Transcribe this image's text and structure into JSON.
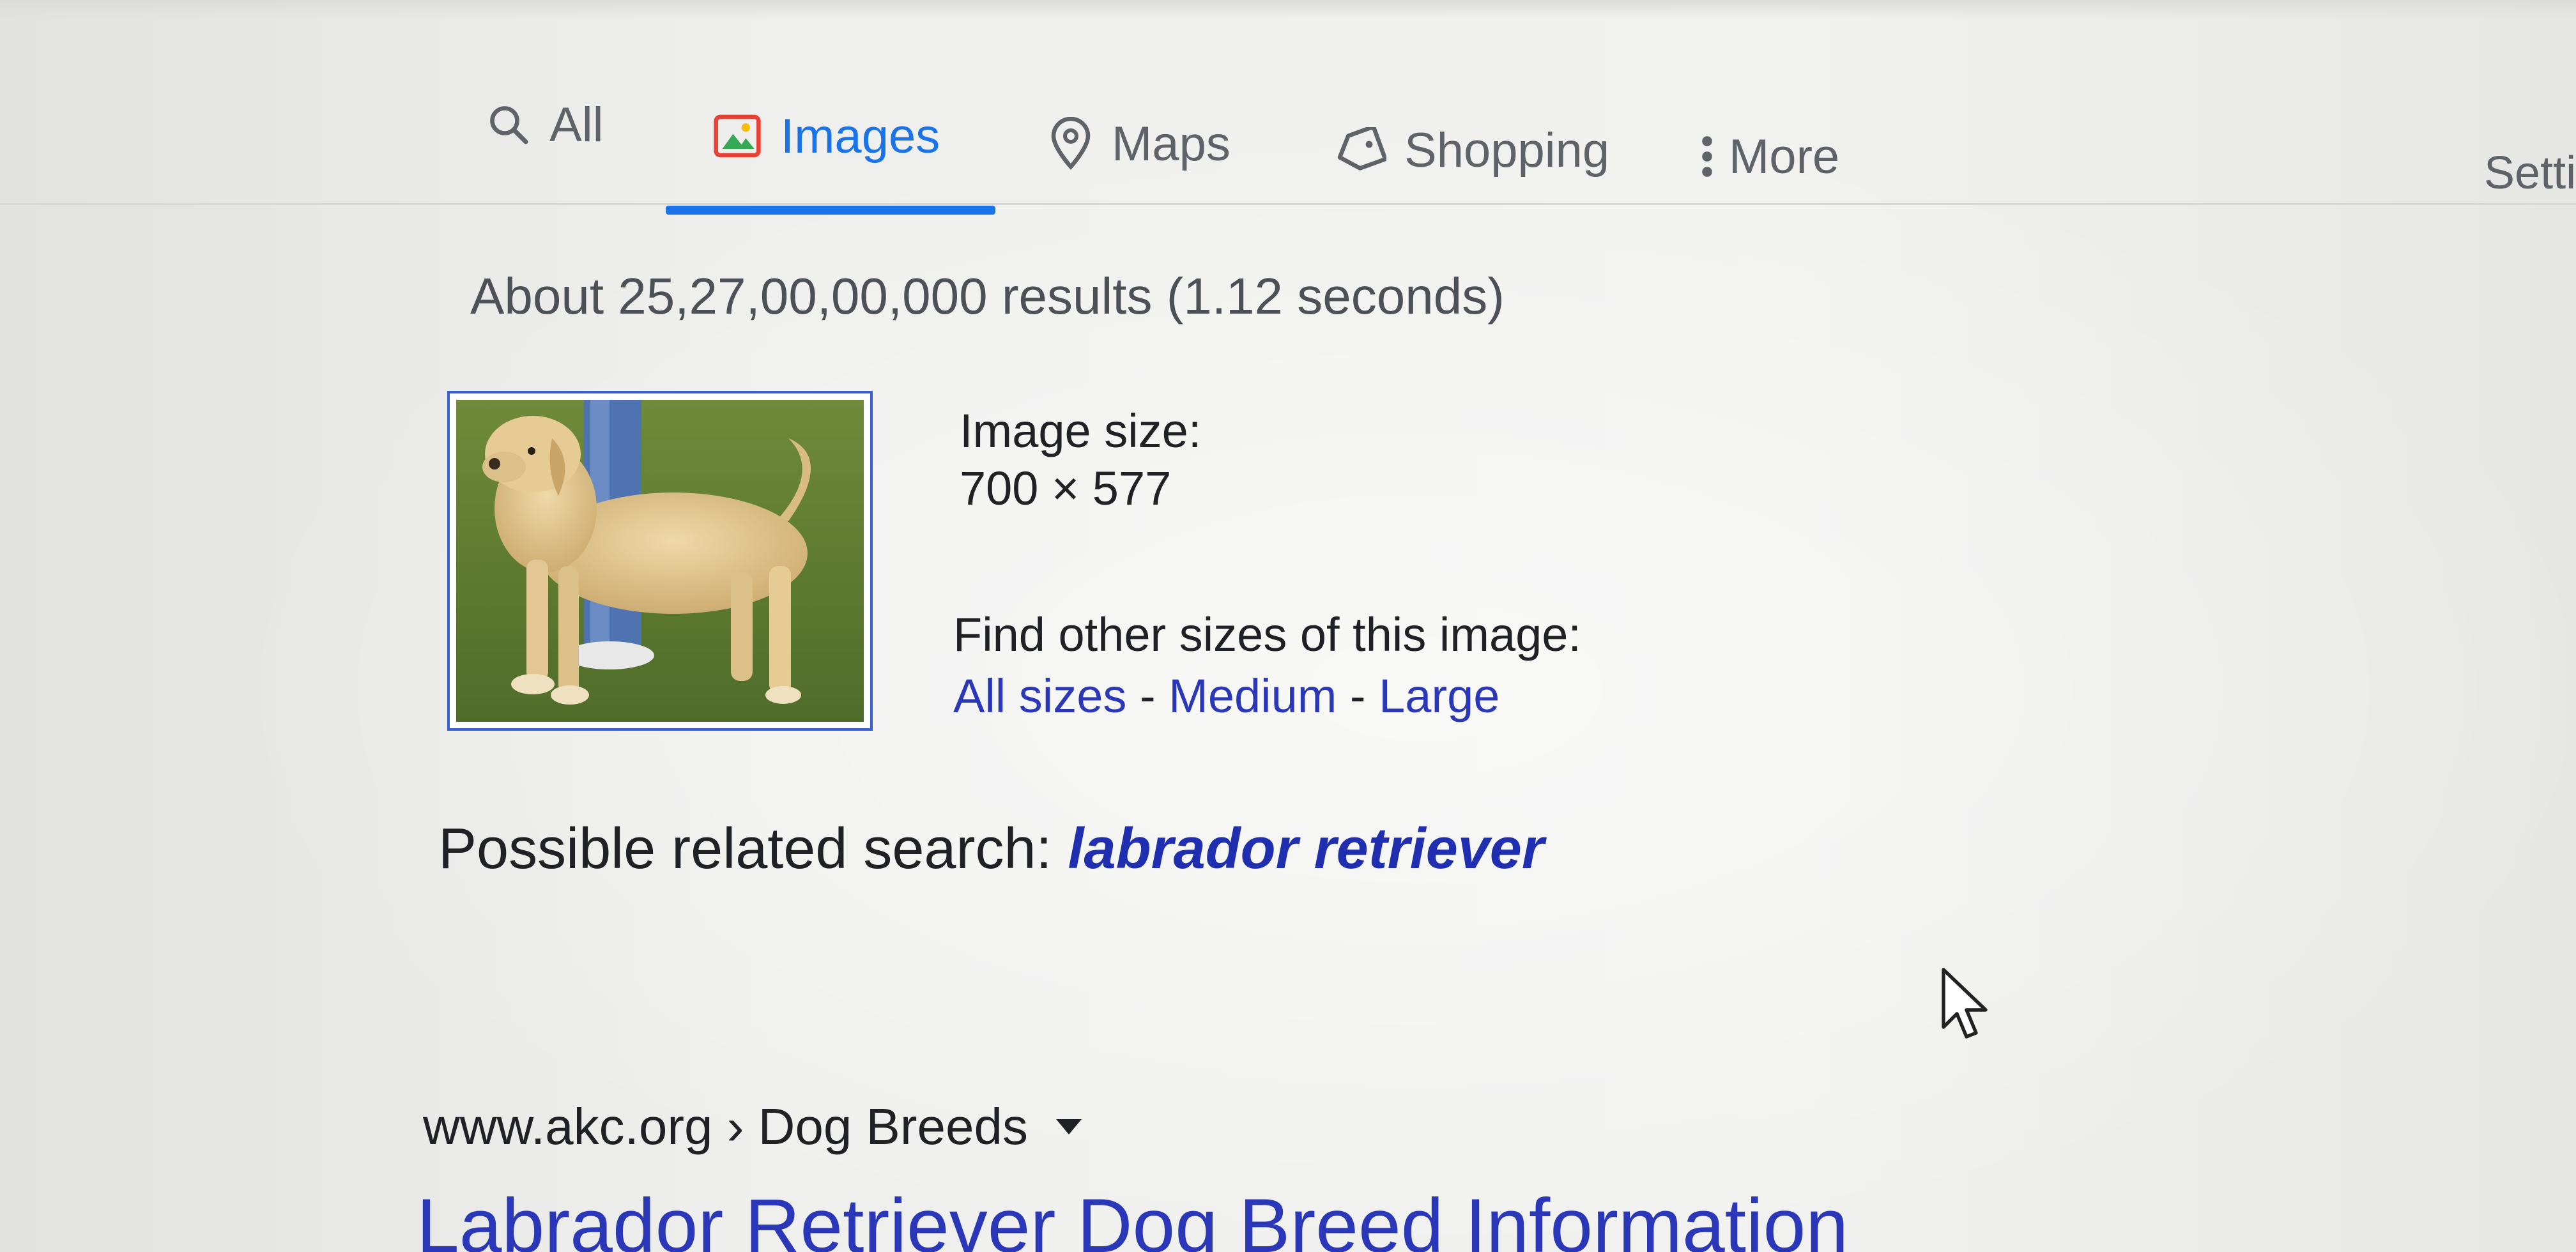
{
  "tabs": [
    {
      "label": "All",
      "icon": "search-icon",
      "active": false
    },
    {
      "label": "Images",
      "icon": "image-icon",
      "active": true
    },
    {
      "label": "Maps",
      "icon": "map-pin-icon",
      "active": false
    },
    {
      "label": "Shopping",
      "icon": "tag-icon",
      "active": false
    },
    {
      "label": "More",
      "icon": "more-vertical-icon",
      "active": false
    }
  ],
  "settings_label": "Setti",
  "result_stats": "About 25,27,00,00,000 results (1.12 seconds)",
  "image_info": {
    "size_label": "Image size:",
    "size_value": "700 × 577",
    "other_sizes_label": "Find other sizes of this image:",
    "links": [
      "All sizes",
      "Medium",
      "Large"
    ],
    "separator": " - "
  },
  "related": {
    "label": "Possible related search:",
    "query": "labrador retriever"
  },
  "result": {
    "breadcrumb": "www.akc.org › Dog Breeds",
    "title": "Labrador Retriever Dog Breed Information"
  },
  "colors": {
    "accent": "#1a73e8",
    "link": "#2a37b8",
    "text": "#202124",
    "muted": "#5f6368"
  }
}
